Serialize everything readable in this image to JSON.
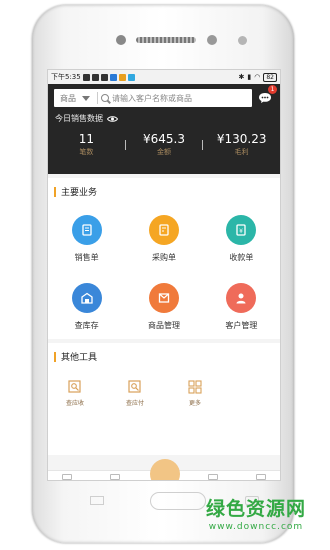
{
  "status_bar": {
    "time": "下午5:35",
    "battery": "82"
  },
  "header": {
    "search_type": "商品",
    "search_placeholder": "请输入客户名称或商品",
    "message_badge": "1",
    "today_label": "今日销售数据",
    "stats": [
      {
        "value": "11",
        "label": "笔数"
      },
      {
        "value": "¥645.3",
        "label": "金额"
      },
      {
        "value": "¥130.23",
        "label": "毛利"
      }
    ]
  },
  "main_business": {
    "title": "主要业务",
    "items": [
      {
        "label": "销售单",
        "color": "#3a9fe8"
      },
      {
        "label": "采购单",
        "color": "#f5a623"
      },
      {
        "label": "收款单",
        "color": "#2bb6a8"
      },
      {
        "label": "查库存",
        "color": "#3a87d9"
      },
      {
        "label": "商品管理",
        "color": "#f07a3b"
      },
      {
        "label": "客户管理",
        "color": "#ef6b5a"
      }
    ]
  },
  "other_tools": {
    "title": "其他工具",
    "items": [
      {
        "label": "查应收"
      },
      {
        "label": "查应付"
      },
      {
        "label": "更多"
      }
    ]
  },
  "watermark": {
    "title": "绿色资源网",
    "url": "www.downcc.com"
  }
}
